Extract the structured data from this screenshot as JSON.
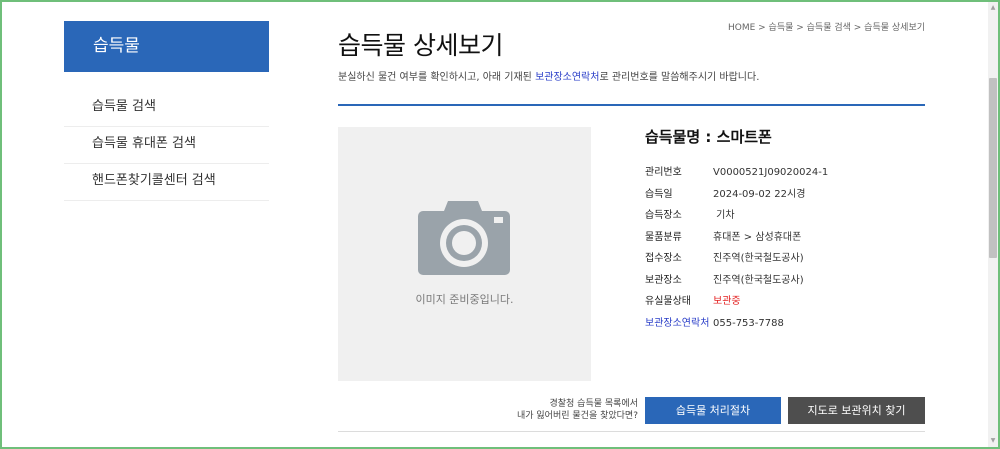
{
  "sidebar": {
    "title": "습득물",
    "items": [
      {
        "label": "습득물 검색"
      },
      {
        "label": "습득물 휴대폰 검색"
      },
      {
        "label": "핸드폰찾기콜센터 검색"
      }
    ]
  },
  "breadcrumb": "HOME > 습득물 > 습득물 검색 > 습득물 상세보기",
  "page": {
    "title": "습득물 상세보기",
    "subtitle_before": "분실하신 물건 여부를 확인하시고, 아래 기재된 ",
    "subtitle_highlight": "보관장소연락처",
    "subtitle_after": "로 관리번호를 말씀해주시기 바랍니다."
  },
  "image": {
    "icon": "camera-icon",
    "caption": "이미지 준비중입니다."
  },
  "item": {
    "name": "습득물명 : 스마트폰",
    "details": [
      {
        "label": "관리번호",
        "value": "V0000521J09020024-1"
      },
      {
        "label": "습득일",
        "value": "2024-09-02 22시경"
      },
      {
        "label": "습득장소",
        "value": " 기차"
      },
      {
        "label": "물품분류",
        "value": "휴대폰 > 삼성휴대폰"
      },
      {
        "label": "접수장소",
        "value": "진주역(한국철도공사)"
      },
      {
        "label": "보관장소",
        "value": "진주역(한국철도공사)"
      },
      {
        "label": "유실물상태",
        "value": "보관중"
      },
      {
        "label": "보관장소연락처",
        "value": "055-753-7788"
      }
    ]
  },
  "help_text": {
    "line1": "경찰청 습득물 목록에서",
    "line2": "내가 잃어버린 물건을 찾았다면?"
  },
  "buttons": {
    "procedure": "습득물 처리절차",
    "map": "지도로 보관위치 찾기"
  },
  "colors": {
    "accent": "#2a67b8",
    "highlight": "#2a3ec8",
    "status_red": "#e32020",
    "dark_button": "#4e4e4e"
  }
}
